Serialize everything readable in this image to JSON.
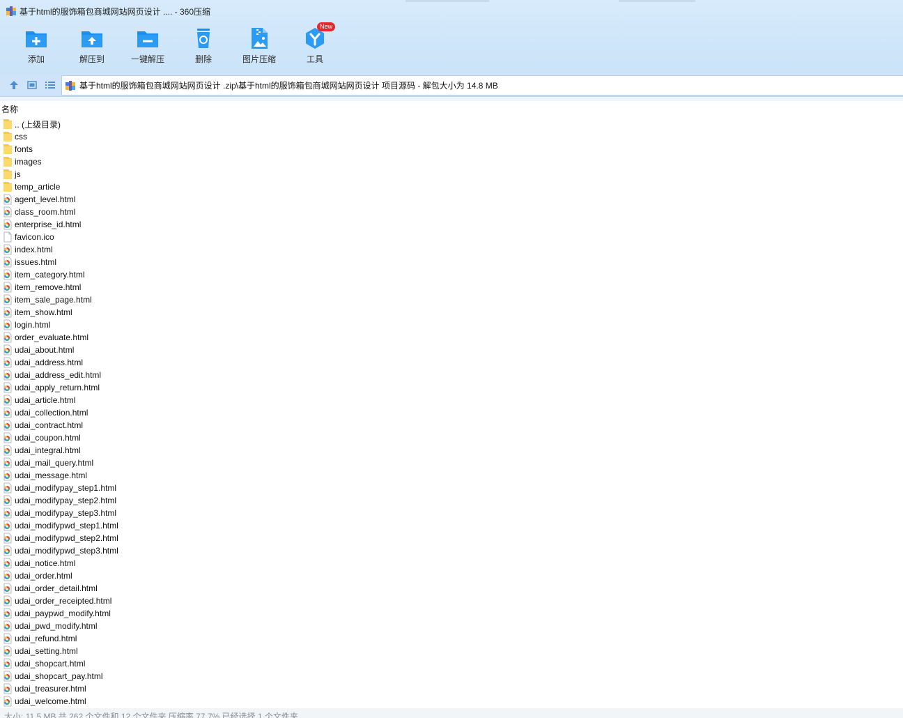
{
  "window": {
    "title": "基于html的服饰箱包商城网站网页设计 .... - 360压缩"
  },
  "toolbar": [
    {
      "name": "add",
      "label": "添加",
      "icon": "folder-plus-icon"
    },
    {
      "name": "extract-to",
      "label": "解压到",
      "icon": "folder-upload-icon"
    },
    {
      "name": "quick-extract",
      "label": "一键解压",
      "icon": "folder-minus-icon"
    },
    {
      "name": "delete",
      "label": "删除",
      "icon": "recycle-bin-icon"
    },
    {
      "name": "image-compress",
      "label": "图片压缩",
      "icon": "image-zip-icon"
    },
    {
      "name": "tools",
      "label": "工具",
      "icon": "tools-y-icon",
      "badge": "New"
    }
  ],
  "address": {
    "path": "基于html的服饰箱包商城网站网页设计 .zip\\基于html的服饰箱包商城网站网页设计 项目源码 - 解包大小为 14.8 MB"
  },
  "list": {
    "column_name": "名称",
    "items": [
      {
        "name": ".. (上级目录)",
        "type": "folder"
      },
      {
        "name": "css",
        "type": "folder"
      },
      {
        "name": "fonts",
        "type": "folder"
      },
      {
        "name": "images",
        "type": "folder"
      },
      {
        "name": "js",
        "type": "folder"
      },
      {
        "name": "temp_article",
        "type": "folder"
      },
      {
        "name": "agent_level.html",
        "type": "html"
      },
      {
        "name": "class_room.html",
        "type": "html"
      },
      {
        "name": "enterprise_id.html",
        "type": "html"
      },
      {
        "name": "favicon.ico",
        "type": "file"
      },
      {
        "name": "index.html",
        "type": "html"
      },
      {
        "name": "issues.html",
        "type": "html"
      },
      {
        "name": "item_category.html",
        "type": "html"
      },
      {
        "name": "item_remove.html",
        "type": "html"
      },
      {
        "name": "item_sale_page.html",
        "type": "html"
      },
      {
        "name": "item_show.html",
        "type": "html"
      },
      {
        "name": "login.html",
        "type": "html"
      },
      {
        "name": "order_evaluate.html",
        "type": "html"
      },
      {
        "name": "udai_about.html",
        "type": "html"
      },
      {
        "name": "udai_address.html",
        "type": "html"
      },
      {
        "name": "udai_address_edit.html",
        "type": "html"
      },
      {
        "name": "udai_apply_return.html",
        "type": "html"
      },
      {
        "name": "udai_article.html",
        "type": "html"
      },
      {
        "name": "udai_collection.html",
        "type": "html"
      },
      {
        "name": "udai_contract.html",
        "type": "html"
      },
      {
        "name": "udai_coupon.html",
        "type": "html"
      },
      {
        "name": "udai_integral.html",
        "type": "html"
      },
      {
        "name": "udai_mail_query.html",
        "type": "html"
      },
      {
        "name": "udai_message.html",
        "type": "html"
      },
      {
        "name": "udai_modifypay_step1.html",
        "type": "html"
      },
      {
        "name": "udai_modifypay_step2.html",
        "type": "html"
      },
      {
        "name": "udai_modifypay_step3.html",
        "type": "html"
      },
      {
        "name": "udai_modifypwd_step1.html",
        "type": "html"
      },
      {
        "name": "udai_modifypwd_step2.html",
        "type": "html"
      },
      {
        "name": "udai_modifypwd_step3.html",
        "type": "html"
      },
      {
        "name": "udai_notice.html",
        "type": "html"
      },
      {
        "name": "udai_order.html",
        "type": "html"
      },
      {
        "name": "udai_order_detail.html",
        "type": "html"
      },
      {
        "name": "udai_order_receipted.html",
        "type": "html"
      },
      {
        "name": "udai_paypwd_modify.html",
        "type": "html"
      },
      {
        "name": "udai_pwd_modify.html",
        "type": "html"
      },
      {
        "name": "udai_refund.html",
        "type": "html"
      },
      {
        "name": "udai_setting.html",
        "type": "html"
      },
      {
        "name": "udai_shopcart.html",
        "type": "html"
      },
      {
        "name": "udai_shopcart_pay.html",
        "type": "html"
      },
      {
        "name": "udai_treasurer.html",
        "type": "html"
      },
      {
        "name": "udai_welcome.html",
        "type": "html"
      }
    ]
  },
  "status": {
    "text": "大小: 11.5 MB 共 262 个文件和 12 个文件夹 压缩率 77.7% 已经选择 1 个文件夹"
  },
  "colors": {
    "toolbar_bg": "#cfe6fa",
    "icon_blue": "#1a8df0",
    "folder_yellow": "#fbd96b",
    "badge_red": "#e8262b",
    "status_text": "#8a8f96"
  }
}
